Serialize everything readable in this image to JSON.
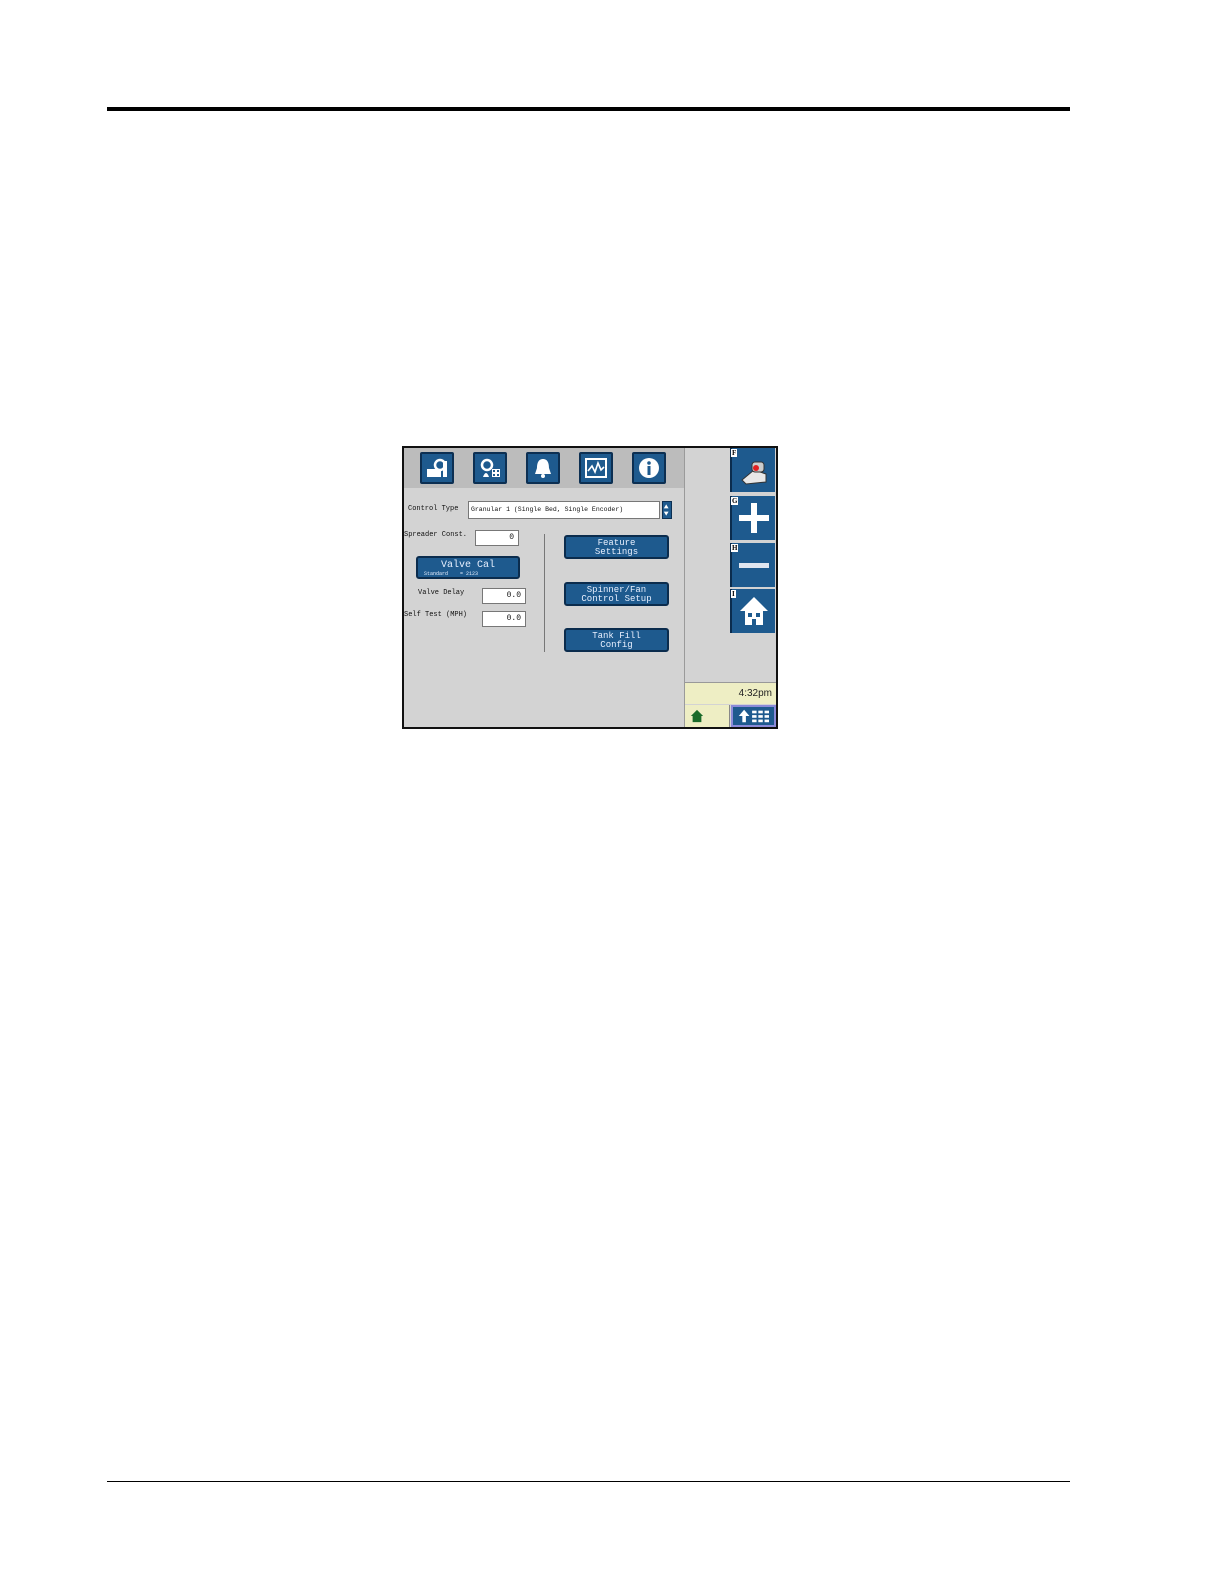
{
  "tabs": [
    {
      "icon": "tools-icon"
    },
    {
      "icon": "product-settings-icon"
    },
    {
      "icon": "alarm-bell-icon"
    },
    {
      "icon": "diagnostics-chart-icon"
    },
    {
      "icon": "info-icon"
    }
  ],
  "form": {
    "control_type_label": "Control Type",
    "control_type_value": "Granular 1 (Single Bed, Single Encoder)",
    "spreader_const_label": "Spreader Const.",
    "spreader_const_value": "0",
    "valve_cal_label": "Valve Cal",
    "valve_cal_sub": "Standard    = 2123",
    "valve_delay_label": "Valve Delay",
    "valve_delay_value": "0.0",
    "self_test_label": "Self Test (MPH)",
    "self_test_value": "0.0"
  },
  "buttons": {
    "feature_settings": [
      "Feature",
      "Settings"
    ],
    "spinner_fan": [
      "Spinner/Fan",
      "Control Setup"
    ],
    "tank_fill": [
      "Tank Fill",
      "Config"
    ]
  },
  "side_keys": [
    {
      "letter": "F",
      "icon": "operator-hand-icon"
    },
    {
      "letter": "G",
      "icon": "plus-icon"
    },
    {
      "letter": "H",
      "icon": "minus-icon"
    },
    {
      "letter": "I",
      "icon": "home-icon"
    }
  ],
  "status": {
    "time": "4:32pm"
  },
  "colors": {
    "button_blue": "#1e5a8e",
    "screen_gray": "#d3d3d3",
    "clock_bg": "#eeeec4"
  }
}
